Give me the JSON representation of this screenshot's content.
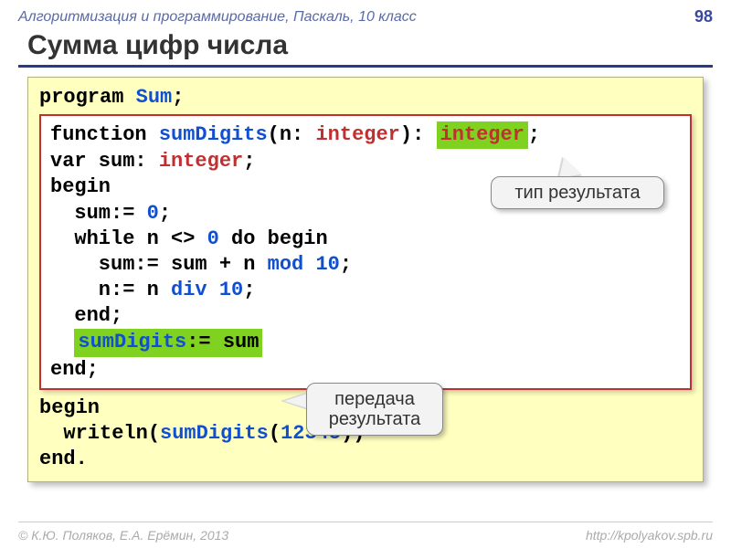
{
  "header": {
    "course": "Алгоритмизация и программирование, Паскаль, 10 класс",
    "page": "98"
  },
  "title": "Сумма цифр числа",
  "code": {
    "program_kw": "program ",
    "program_name": "Sum",
    "semicolon": ";",
    "fn_kw": "function ",
    "fn_name": "sumDigits",
    "fn_sig_open": "(n: ",
    "type_int": "integer",
    "fn_sig_close": "): ",
    "fn_ret_hl": "integer",
    "fn_end_sc": ";",
    "var_line_a": "var sum: ",
    "var_line_b": "integer",
    "var_line_c": ";",
    "begin": "begin",
    "l_sum0a": "  sum:= ",
    "l_sum0b": "0",
    "l_sum0c": ";",
    "l_while_a": "  while n <> ",
    "l_while_b": "0",
    "l_while_c": " do begin",
    "l_mod_a": "    sum:= sum + n ",
    "l_mod_b": "mod",
    "l_mod_c": " ",
    "l_mod_d": "10",
    "l_mod_e": ";",
    "l_div_a": "    n:= n ",
    "l_div_b": "div",
    "l_div_c": " ",
    "l_div_d": "10",
    "l_div_e": ";",
    "l_end": "  end;",
    "l_ret_hl_a": "sumDigits",
    "l_ret_hl_b": ":= sum",
    "end_fn": "end;",
    "main_begin": "begin",
    "main_wr_a": "  writeln(",
    "main_wr_b": "sumDigits",
    "main_wr_c": "(",
    "main_wr_d": "12345",
    "main_wr_e": "))",
    "main_end": "end."
  },
  "callouts": {
    "c1": "тип результата",
    "c2": "передача\nрезультата"
  },
  "footer": {
    "left": "© К.Ю. Поляков, Е.А. Ерёмин, 2013",
    "right": "http://kpolyakov.spb.ru"
  }
}
